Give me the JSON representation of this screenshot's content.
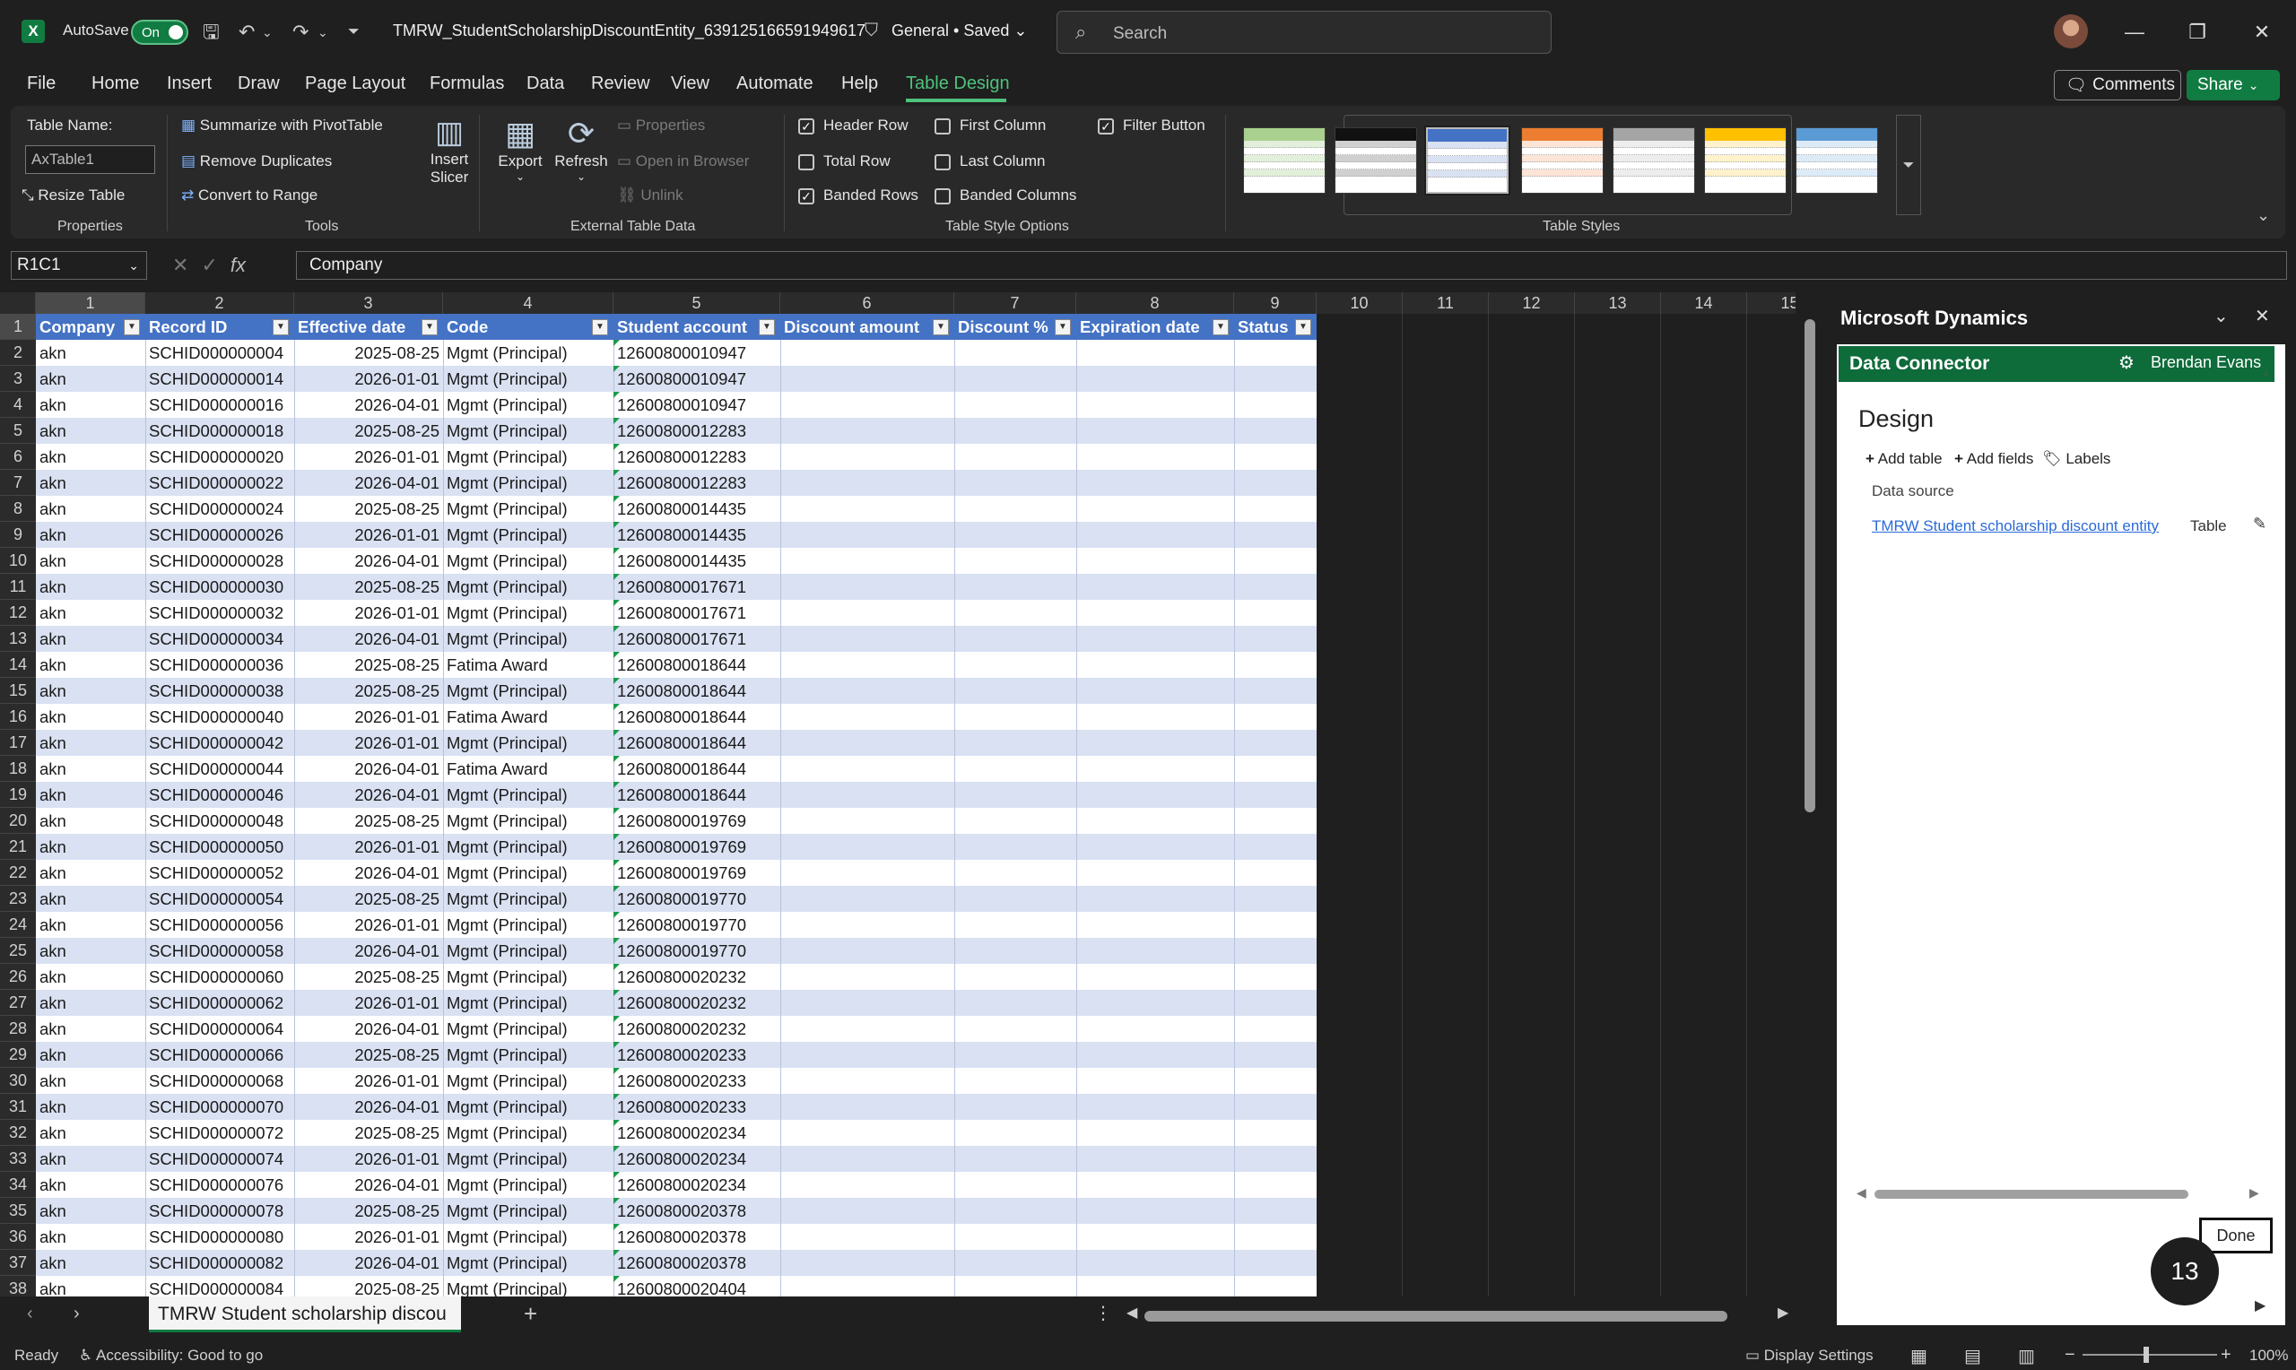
{
  "titlebar": {
    "app_logo": "X",
    "autosave_label": "AutoSave",
    "autosave_state": "On",
    "document_title": "TMRW_StudentScholarshipDiscountEntity_639125166591949617",
    "sensitivity": "General • Saved",
    "search_placeholder": "Search"
  },
  "menu": {
    "tabs": [
      "File",
      "Home",
      "Insert",
      "Draw",
      "Page Layout",
      "Formulas",
      "Data",
      "Review",
      "View",
      "Automate",
      "Help",
      "Table Design"
    ],
    "active": "Table Design",
    "comments_label": "Comments",
    "share_label": "Share"
  },
  "ribbon": {
    "properties": {
      "table_name_label": "Table Name:",
      "table_name_value": "AxTable1",
      "resize_label": "Resize Table",
      "group_label": "Properties"
    },
    "tools": {
      "summarize": "Summarize with PivotTable",
      "remove_duplicates": "Remove Duplicates",
      "convert": "Convert to Range",
      "insert_slicer_1": "Insert",
      "insert_slicer_2": "Slicer",
      "group_label": "Tools"
    },
    "external": {
      "export": "Export",
      "refresh": "Refresh",
      "properties": "Properties",
      "open_browser": "Open in Browser",
      "unlink": "Unlink",
      "group_label": "External Table Data"
    },
    "style_options": {
      "header_row": "Header Row",
      "total_row": "Total Row",
      "banded_rows": "Banded Rows",
      "first_column": "First Column",
      "last_column": "Last Column",
      "banded_columns": "Banded Columns",
      "filter_button": "Filter Button",
      "group_label": "Table Style Options"
    },
    "table_styles_label": "Table Styles"
  },
  "formula_bar": {
    "name_box": "R1C1",
    "formula": "Company"
  },
  "grid": {
    "column_numbers": [
      "1",
      "2",
      "3",
      "4",
      "5",
      "6",
      "7",
      "8",
      "9",
      "10",
      "11",
      "12",
      "13",
      "14",
      "15"
    ],
    "headers": [
      "Company",
      "Record ID",
      "Effective date",
      "Code",
      "Student account",
      "Discount amount",
      "Discount %",
      "Expiration date",
      "Status"
    ],
    "rows": [
      [
        "akn",
        "SCHID000000004",
        "2025-08-25",
        "Mgmt (Principal)",
        "12600800010947"
      ],
      [
        "akn",
        "SCHID000000014",
        "2026-01-01",
        "Mgmt (Principal)",
        "12600800010947"
      ],
      [
        "akn",
        "SCHID000000016",
        "2026-04-01",
        "Mgmt (Principal)",
        "12600800010947"
      ],
      [
        "akn",
        "SCHID000000018",
        "2025-08-25",
        "Mgmt (Principal)",
        "12600800012283"
      ],
      [
        "akn",
        "SCHID000000020",
        "2026-01-01",
        "Mgmt (Principal)",
        "12600800012283"
      ],
      [
        "akn",
        "SCHID000000022",
        "2026-04-01",
        "Mgmt (Principal)",
        "12600800012283"
      ],
      [
        "akn",
        "SCHID000000024",
        "2025-08-25",
        "Mgmt (Principal)",
        "12600800014435"
      ],
      [
        "akn",
        "SCHID000000026",
        "2026-01-01",
        "Mgmt (Principal)",
        "12600800014435"
      ],
      [
        "akn",
        "SCHID000000028",
        "2026-04-01",
        "Mgmt (Principal)",
        "12600800014435"
      ],
      [
        "akn",
        "SCHID000000030",
        "2025-08-25",
        "Mgmt (Principal)",
        "12600800017671"
      ],
      [
        "akn",
        "SCHID000000032",
        "2026-01-01",
        "Mgmt (Principal)",
        "12600800017671"
      ],
      [
        "akn",
        "SCHID000000034",
        "2026-04-01",
        "Mgmt (Principal)",
        "12600800017671"
      ],
      [
        "akn",
        "SCHID000000036",
        "2025-08-25",
        "Fatima Award",
        "12600800018644"
      ],
      [
        "akn",
        "SCHID000000038",
        "2025-08-25",
        "Mgmt (Principal)",
        "12600800018644"
      ],
      [
        "akn",
        "SCHID000000040",
        "2026-01-01",
        "Fatima Award",
        "12600800018644"
      ],
      [
        "akn",
        "SCHID000000042",
        "2026-01-01",
        "Mgmt (Principal)",
        "12600800018644"
      ],
      [
        "akn",
        "SCHID000000044",
        "2026-04-01",
        "Fatima Award",
        "12600800018644"
      ],
      [
        "akn",
        "SCHID000000046",
        "2026-04-01",
        "Mgmt (Principal)",
        "12600800018644"
      ],
      [
        "akn",
        "SCHID000000048",
        "2025-08-25",
        "Mgmt (Principal)",
        "12600800019769"
      ],
      [
        "akn",
        "SCHID000000050",
        "2026-01-01",
        "Mgmt (Principal)",
        "12600800019769"
      ],
      [
        "akn",
        "SCHID000000052",
        "2026-04-01",
        "Mgmt (Principal)",
        "12600800019769"
      ],
      [
        "akn",
        "SCHID000000054",
        "2025-08-25",
        "Mgmt (Principal)",
        "12600800019770"
      ],
      [
        "akn",
        "SCHID000000056",
        "2026-01-01",
        "Mgmt (Principal)",
        "12600800019770"
      ],
      [
        "akn",
        "SCHID000000058",
        "2026-04-01",
        "Mgmt (Principal)",
        "12600800019770"
      ],
      [
        "akn",
        "SCHID000000060",
        "2025-08-25",
        "Mgmt (Principal)",
        "12600800020232"
      ],
      [
        "akn",
        "SCHID000000062",
        "2026-01-01",
        "Mgmt (Principal)",
        "12600800020232"
      ],
      [
        "akn",
        "SCHID000000064",
        "2026-04-01",
        "Mgmt (Principal)",
        "12600800020232"
      ],
      [
        "akn",
        "SCHID000000066",
        "2025-08-25",
        "Mgmt (Principal)",
        "12600800020233"
      ],
      [
        "akn",
        "SCHID000000068",
        "2026-01-01",
        "Mgmt (Principal)",
        "12600800020233"
      ],
      [
        "akn",
        "SCHID000000070",
        "2026-04-01",
        "Mgmt (Principal)",
        "12600800020233"
      ],
      [
        "akn",
        "SCHID000000072",
        "2025-08-25",
        "Mgmt (Principal)",
        "12600800020234"
      ],
      [
        "akn",
        "SCHID000000074",
        "2026-01-01",
        "Mgmt (Principal)",
        "12600800020234"
      ],
      [
        "akn",
        "SCHID000000076",
        "2026-04-01",
        "Mgmt (Principal)",
        "12600800020234"
      ],
      [
        "akn",
        "SCHID000000078",
        "2025-08-25",
        "Mgmt (Principal)",
        "12600800020378"
      ],
      [
        "akn",
        "SCHID000000080",
        "2026-01-01",
        "Mgmt (Principal)",
        "12600800020378"
      ],
      [
        "akn",
        "SCHID000000082",
        "2026-04-01",
        "Mgmt (Principal)",
        "12600800020378"
      ],
      [
        "akn",
        "SCHID000000084",
        "2025-08-25",
        "Mgmt (Principal)",
        "12600800020404"
      ]
    ]
  },
  "sheet": {
    "tab_label": "TMRW Student scholarship discou",
    "add_label": "+"
  },
  "statusbar": {
    "ready": "Ready",
    "accessibility": "Accessibility: Good to go",
    "display_settings": "Display Settings",
    "zoom": "100%"
  },
  "side_panel": {
    "title": "Microsoft Dynamics",
    "connector_title": "Data Connector",
    "user": "Brendan Evans",
    "design_heading": "Design",
    "add_table": "Add table",
    "add_fields": "Add fields",
    "labels": "Labels",
    "data_source_label": "Data source",
    "data_source_link": "TMRW Student scholarship discount entity",
    "data_source_type": "Table",
    "done_label": "Done",
    "step_badge": "13"
  },
  "colors": {
    "accent": "#107c41",
    "table_header": "#4472c4",
    "band": "#d9e1f2",
    "link": "#2a6ad8"
  }
}
